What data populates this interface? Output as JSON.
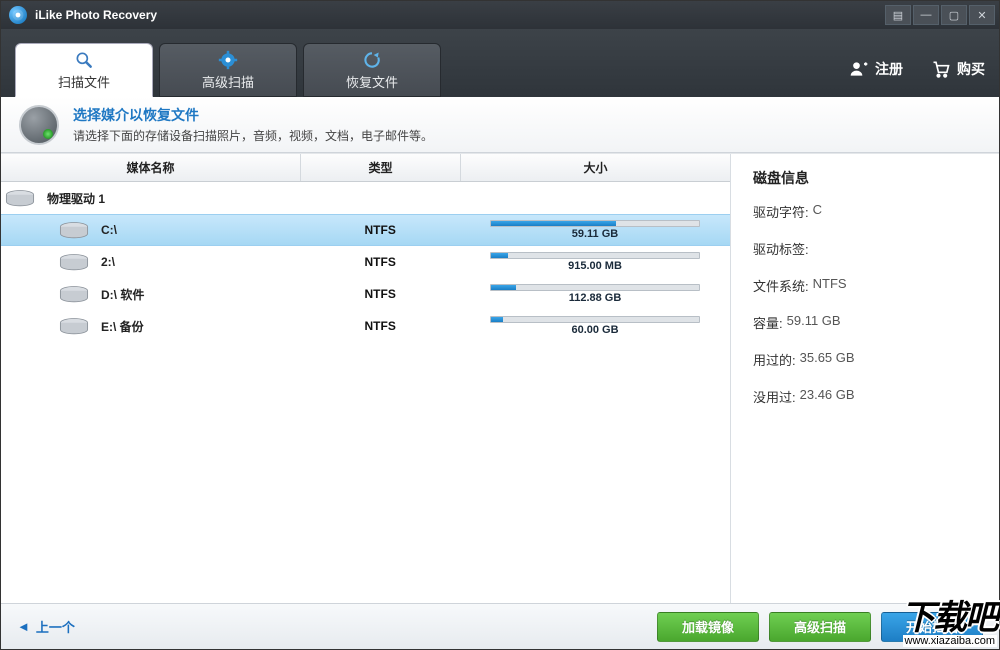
{
  "app": {
    "title": "iLike Photo Recovery"
  },
  "header": {
    "tabs": [
      {
        "label": "扫描文件",
        "icon": "magnifier"
      },
      {
        "label": "高级扫描",
        "icon": "gear"
      },
      {
        "label": "恢复文件",
        "icon": "refresh"
      }
    ],
    "links": {
      "register": "注册",
      "buy": "购买"
    }
  },
  "banner": {
    "title": "选择媒介以恢复文件",
    "desc": "请选择下面的存储设备扫描照片，音频，视频，文档，电子邮件等。"
  },
  "columns": {
    "name": "媒体名称",
    "type": "类型",
    "size": "大小"
  },
  "drives": {
    "group": "物理驱动 1",
    "items": [
      {
        "name": "C:\\",
        "type": "NTFS",
        "size": "59.11 GB",
        "fill": 60
      },
      {
        "name": "2:\\",
        "type": "NTFS",
        "size": "915.00 MB",
        "fill": 8
      },
      {
        "name": "D:\\ 软件",
        "type": "NTFS",
        "size": "112.88 GB",
        "fill": 12
      },
      {
        "name": "E:\\ 备份",
        "type": "NTFS",
        "size": "60.00 GB",
        "fill": 6
      }
    ],
    "selected": 0
  },
  "info": {
    "title": "磁盘信息",
    "rows": {
      "letter": {
        "k": "驱动字符:",
        "v": "C"
      },
      "label": {
        "k": "驱动标签:",
        "v": ""
      },
      "fs": {
        "k": "文件系统:",
        "v": "NTFS"
      },
      "capacity": {
        "k": "容量:",
        "v": "59.11 GB"
      },
      "used": {
        "k": "用过的:",
        "v": "35.65 GB"
      },
      "free": {
        "k": "没用过:",
        "v": "23.46 GB"
      }
    }
  },
  "footer": {
    "prev": "上一个",
    "load": "加载镜像",
    "adv": "高级扫描",
    "start": "开始扫描"
  },
  "watermark": {
    "big": "下载吧",
    "small": "www.xiazaiba.com"
  }
}
